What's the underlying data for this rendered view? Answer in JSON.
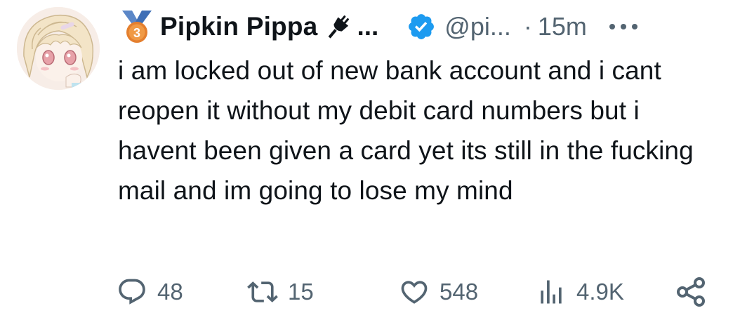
{
  "tweet": {
    "display_name": "Pipkin Pippa",
    "name_overflow": "...",
    "handle": "@pi...",
    "separator": "·",
    "time": "15m",
    "badge_number": "3",
    "text": "i am locked out of new bank account and i cant reopen it without my debit card numbers but i havent been given a card yet its still in the fucking mail and im going to lose my mind"
  },
  "actions": {
    "replies": "48",
    "reposts": "15",
    "likes": "548",
    "views": "4.9K"
  },
  "icons": {
    "badge": "medal-icon",
    "plug": "plug-icon",
    "verified": "verified-check-icon",
    "more": "more-dots-icon",
    "reply": "reply-icon",
    "repost": "repost-icon",
    "like": "heart-icon",
    "views": "analytics-bars-icon",
    "share": "share-icon"
  },
  "colors": {
    "text": "#0f1419",
    "muted": "#536471",
    "verified": "#1d9bf0",
    "badge_ribbon": "#5b87c7",
    "badge_medal": "#e47f2e"
  }
}
